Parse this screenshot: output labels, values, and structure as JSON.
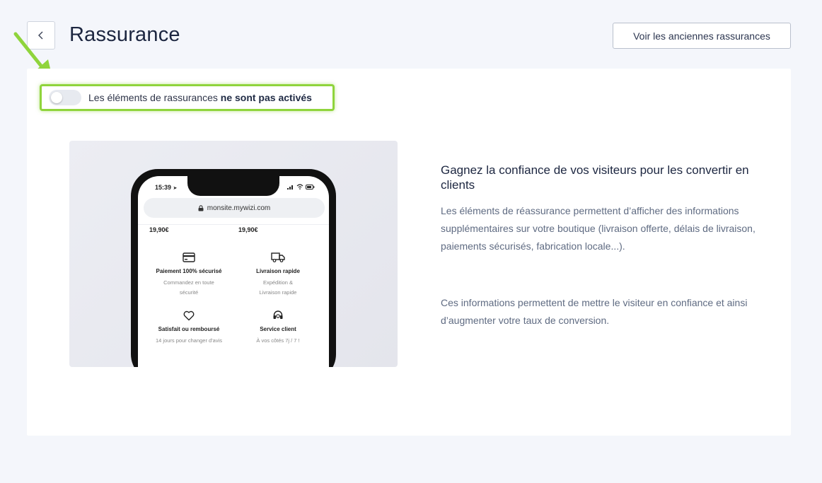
{
  "header": {
    "title": "Rassurance",
    "old_button_label": "Voir les anciennes rassurances"
  },
  "toggle": {
    "label_prefix": "Les éléments de rassurances",
    "label_bold": "ne sont pas activés",
    "enabled": false
  },
  "preview": {
    "status_time": "15:39",
    "url": "monsite.mywizi.com",
    "prices": [
      "19,90€",
      "19,90€"
    ],
    "features": [
      {
        "icon": "credit-card-icon",
        "title": "Paiement 100% sécurisé",
        "sub1": "Commandez en toute",
        "sub2": "sécurité"
      },
      {
        "icon": "truck-icon",
        "title": "Livraison rapide",
        "sub1": "Expédition &",
        "sub2": "Livraison rapide"
      },
      {
        "icon": "heart-icon",
        "title": "Satisfait ou remboursé",
        "sub1": "14 jours pour changer d'avis",
        "sub2": ""
      },
      {
        "icon": "headset-icon",
        "title": "Service client",
        "sub1": "À vos côtés 7j / 7 !",
        "sub2": ""
      }
    ]
  },
  "info": {
    "headline": "Gagnez la confiance de vos visiteurs pour les convertir en clients",
    "paragraph1": "Les éléments de réassurance permettent d’afficher des informations supplémentaires sur votre boutique (livraison offerte, délais de livraison, paiements sécurisés, fabrication locale...).",
    "paragraph2": "Ces informations permettent de mettre le visiteur en confiance et ainsi d’augmenter votre taux de conversion."
  },
  "colors": {
    "highlight": "#8fd43c",
    "background": "#f4f6fb"
  }
}
